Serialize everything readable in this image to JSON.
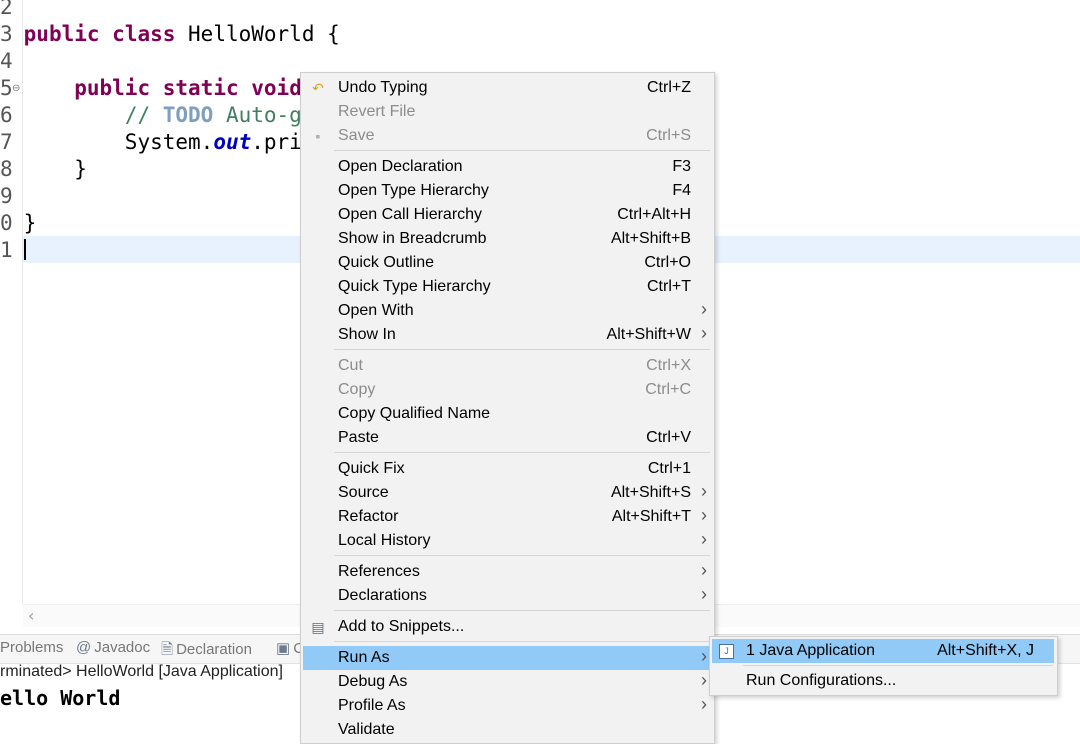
{
  "editor": {
    "lines": [
      {
        "num": "2",
        "segments": []
      },
      {
        "num": "3",
        "segments": [
          {
            "t": "public",
            "c": "kw"
          },
          {
            "t": " "
          },
          {
            "t": "class",
            "c": "kw"
          },
          {
            "t": " HelloWorld {"
          }
        ]
      },
      {
        "num": "4",
        "segments": []
      },
      {
        "num": "5",
        "segments": [
          {
            "t": "    "
          },
          {
            "t": "public",
            "c": "kw"
          },
          {
            "t": " "
          },
          {
            "t": "static",
            "c": "kw"
          },
          {
            "t": " "
          },
          {
            "t": "void",
            "c": "kw"
          }
        ]
      },
      {
        "num": "6",
        "segments": [
          {
            "t": "        "
          },
          {
            "t": "// ",
            "c": "cm"
          },
          {
            "t": "TODO",
            "c": "todo"
          },
          {
            "t": " Auto-g",
            "c": "cm"
          }
        ]
      },
      {
        "num": "7",
        "segments": [
          {
            "t": "        System."
          },
          {
            "t": "out",
            "c": "fld"
          },
          {
            "t": ".pri"
          }
        ]
      },
      {
        "num": "8",
        "segments": [
          {
            "t": "    }"
          }
        ]
      },
      {
        "num": "9",
        "segments": []
      },
      {
        "num": "0",
        "segments": [
          {
            "t": "}"
          }
        ]
      },
      {
        "num": "1",
        "segments": []
      }
    ],
    "fold_marker": "⊖"
  },
  "panel": {
    "tabs": [
      {
        "label": "Problems",
        "icon": "problems-icon",
        "glyph": ""
      },
      {
        "label": "Javadoc",
        "icon": "javadoc-icon",
        "glyph": "@"
      },
      {
        "label": "Declaration",
        "icon": "declaration-icon",
        "glyph": "🗎"
      },
      {
        "label": "C",
        "icon": "console-icon",
        "glyph": "▣"
      }
    ],
    "console_status": "rminated> HelloWorld [Java Application]",
    "console_output": "ello World"
  },
  "context_menu": {
    "items": [
      {
        "label": "Undo Typing",
        "shortcut": "Ctrl+Z",
        "icon": "undo-icon",
        "glyph": "↶",
        "color": "#d9a520",
        "disabled": false,
        "submenu": false
      },
      {
        "label": "Revert File",
        "shortcut": "",
        "disabled": true,
        "submenu": false
      },
      {
        "label": "Save",
        "shortcut": "Ctrl+S",
        "icon": "save-icon",
        "glyph": "▪",
        "color": "#b0b0b0",
        "disabled": true,
        "submenu": false
      },
      {
        "separator": true
      },
      {
        "label": "Open Declaration",
        "shortcut": "F3",
        "disabled": false,
        "submenu": false
      },
      {
        "label": "Open Type Hierarchy",
        "shortcut": "F4",
        "disabled": false,
        "submenu": false
      },
      {
        "label": "Open Call Hierarchy",
        "shortcut": "Ctrl+Alt+H",
        "disabled": false,
        "submenu": false
      },
      {
        "label": "Show in Breadcrumb",
        "shortcut": "Alt+Shift+B",
        "disabled": false,
        "submenu": false
      },
      {
        "label": "Quick Outline",
        "shortcut": "Ctrl+O",
        "disabled": false,
        "submenu": false
      },
      {
        "label": "Quick Type Hierarchy",
        "shortcut": "Ctrl+T",
        "disabled": false,
        "submenu": false
      },
      {
        "label": "Open With",
        "shortcut": "",
        "disabled": false,
        "submenu": true
      },
      {
        "label": "Show In",
        "shortcut": "Alt+Shift+W",
        "disabled": false,
        "submenu": true
      },
      {
        "separator": true
      },
      {
        "label": "Cut",
        "shortcut": "Ctrl+X",
        "disabled": true,
        "submenu": false
      },
      {
        "label": "Copy",
        "shortcut": "Ctrl+C",
        "disabled": true,
        "submenu": false
      },
      {
        "label": "Copy Qualified Name",
        "shortcut": "",
        "disabled": false,
        "submenu": false
      },
      {
        "label": "Paste",
        "shortcut": "Ctrl+V",
        "disabled": false,
        "submenu": false
      },
      {
        "separator": true
      },
      {
        "label": "Quick Fix",
        "shortcut": "Ctrl+1",
        "disabled": false,
        "submenu": false
      },
      {
        "label": "Source",
        "shortcut": "Alt+Shift+S",
        "disabled": false,
        "submenu": true
      },
      {
        "label": "Refactor",
        "shortcut": "Alt+Shift+T",
        "disabled": false,
        "submenu": true
      },
      {
        "label": "Local History",
        "shortcut": "",
        "disabled": false,
        "submenu": true
      },
      {
        "separator": true
      },
      {
        "label": "References",
        "shortcut": "",
        "disabled": false,
        "submenu": true
      },
      {
        "label": "Declarations",
        "shortcut": "",
        "disabled": false,
        "submenu": true
      },
      {
        "separator": true
      },
      {
        "label": "Add to Snippets...",
        "shortcut": "",
        "icon": "snippets-icon",
        "glyph": "▤",
        "color": "#5a6b7d",
        "disabled": false,
        "submenu": false
      },
      {
        "separator": true
      },
      {
        "label": "Run As",
        "shortcut": "",
        "disabled": false,
        "submenu": true,
        "highlighted": true
      },
      {
        "label": "Debug As",
        "shortcut": "",
        "disabled": false,
        "submenu": true
      },
      {
        "label": "Profile As",
        "shortcut": "",
        "disabled": false,
        "submenu": true
      },
      {
        "label": "Validate",
        "shortcut": "",
        "disabled": false,
        "submenu": false
      }
    ],
    "submenu_arrow": "›"
  },
  "run_as_submenu": {
    "items": [
      {
        "label": "1 Java Application",
        "shortcut": "Alt+Shift+X, J",
        "icon": "java-app-icon",
        "glyph": "J",
        "highlighted": true
      },
      {
        "separator": true
      },
      {
        "label": "Run Configurations...",
        "shortcut": ""
      }
    ]
  },
  "colors": {
    "keyword": "#7f0055",
    "comment": "#3f7f5f",
    "menu_highlight": "#91c9f7",
    "current_line": "#e8f2fe"
  }
}
